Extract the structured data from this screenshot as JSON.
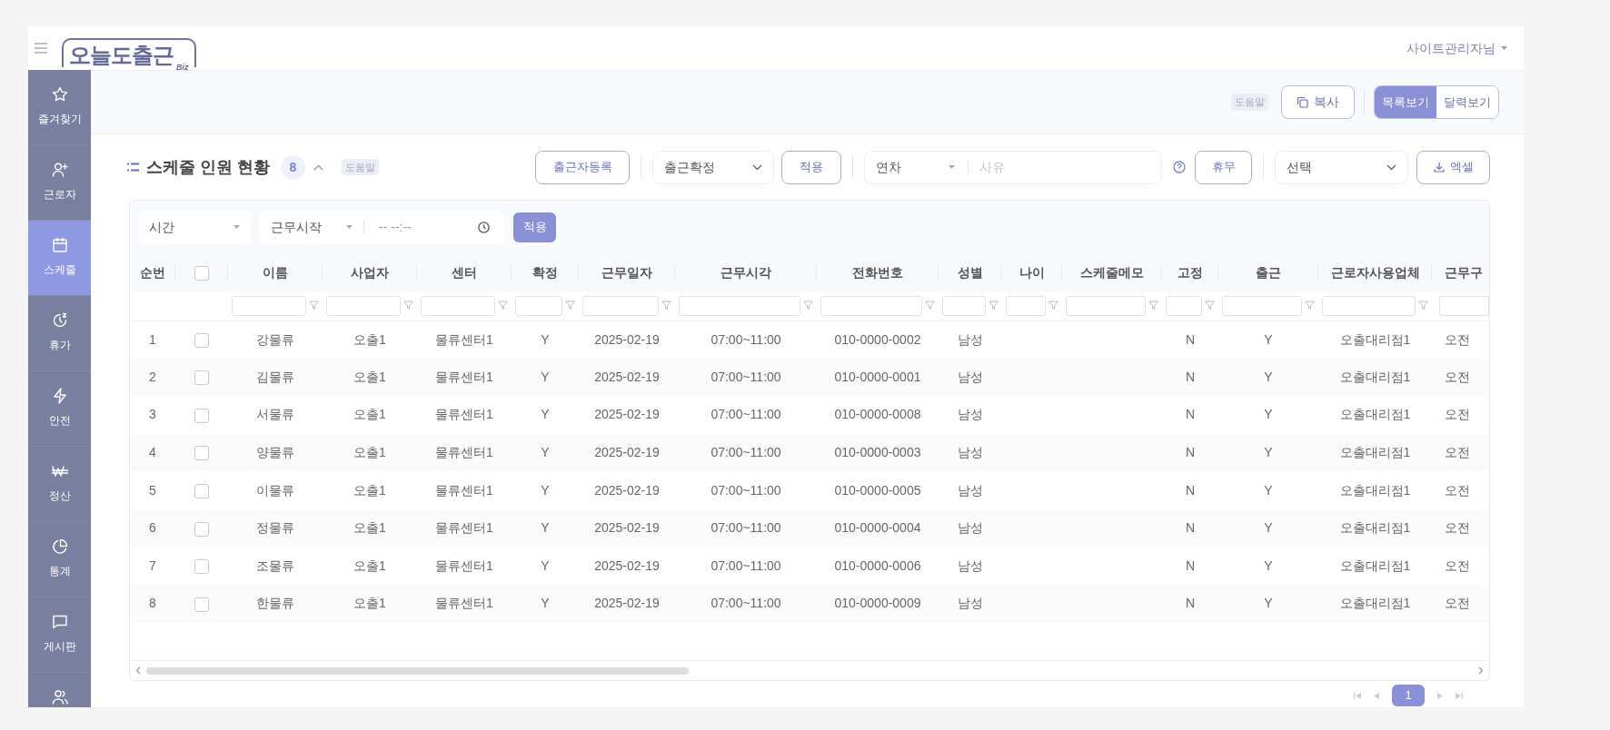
{
  "header": {
    "logo": "오늘도출근",
    "logo_sub": "Biz",
    "user": "사이트관리자님"
  },
  "sidebar": {
    "items": [
      {
        "label": "즐겨찾기",
        "selected": false
      },
      {
        "label": "근로자",
        "selected": false
      },
      {
        "label": "스케줄",
        "selected": true
      },
      {
        "label": "휴가",
        "selected": false
      },
      {
        "label": "안전",
        "selected": false
      },
      {
        "label": "정산",
        "selected": false
      },
      {
        "label": "통계",
        "selected": false
      },
      {
        "label": "게시판",
        "selected": false
      },
      {
        "selected": false
      }
    ]
  },
  "toolbar": {
    "help": "도움말",
    "copy": "복사",
    "views": [
      {
        "label": "목록보기",
        "selected": true
      },
      {
        "label": "달력보기",
        "selected": false
      }
    ]
  },
  "section": {
    "title": "스케줄 인원 현황",
    "count": "8",
    "help": "도움말",
    "register": "출근자등록",
    "confirm_select": "출근확정",
    "apply": "적용",
    "leave_type": "연차",
    "reason_placeholder": "사유",
    "off": "휴무",
    "choice_select": "선택",
    "excel": "엑셀"
  },
  "filter": {
    "type": "시간",
    "field": "근무시작",
    "time_placeholder": "-- --:--",
    "apply": "적용"
  },
  "table": {
    "select_all": {
      "checked": false
    },
    "columns": [
      {
        "kind": "index",
        "label": "순번"
      },
      {
        "kind": "checkbox"
      },
      {
        "kind": "text",
        "label": "이름"
      },
      {
        "kind": "text",
        "label": "사업자"
      },
      {
        "kind": "text",
        "label": "센터"
      },
      {
        "kind": "text",
        "label": "확정"
      },
      {
        "kind": "text",
        "label": "근무일자"
      },
      {
        "kind": "text",
        "label": "근무시각"
      },
      {
        "kind": "text",
        "label": "전화번호"
      },
      {
        "kind": "text",
        "label": "성별"
      },
      {
        "kind": "text",
        "label": "나이"
      },
      {
        "kind": "text",
        "label": "스케줄메모"
      },
      {
        "kind": "text",
        "label": "고정"
      },
      {
        "kind": "text",
        "label": "출근"
      },
      {
        "kind": "text",
        "label": "근로자사용업체"
      },
      {
        "kind": "text",
        "label": "근무구"
      }
    ],
    "rows": [
      {
        "checked": false,
        "cells": [
          "1",
          "",
          "강물류",
          "오출1",
          "물류센터1",
          "Y",
          "2025-02-19",
          "07:00~11:00",
          "010-0000-0002",
          "남성",
          "",
          "",
          "N",
          "Y",
          "오출대리점1",
          "오전"
        ]
      },
      {
        "checked": false,
        "cells": [
          "2",
          "",
          "김물류",
          "오출1",
          "물류센터1",
          "Y",
          "2025-02-19",
          "07:00~11:00",
          "010-0000-0001",
          "남성",
          "",
          "",
          "N",
          "Y",
          "오출대리점1",
          "오전"
        ]
      },
      {
        "checked": false,
        "cells": [
          "3",
          "",
          "서물류",
          "오출1",
          "물류센터1",
          "Y",
          "2025-02-19",
          "07:00~11:00",
          "010-0000-0008",
          "남성",
          "",
          "",
          "N",
          "Y",
          "오출대리점1",
          "오전"
        ]
      },
      {
        "checked": false,
        "cells": [
          "4",
          "",
          "양물류",
          "오출1",
          "물류센터1",
          "Y",
          "2025-02-19",
          "07:00~11:00",
          "010-0000-0003",
          "남성",
          "",
          "",
          "N",
          "Y",
          "오출대리점1",
          "오전"
        ]
      },
      {
        "checked": false,
        "cells": [
          "5",
          "",
          "이물류",
          "오출1",
          "물류센터1",
          "Y",
          "2025-02-19",
          "07:00~11:00",
          "010-0000-0005",
          "남성",
          "",
          "",
          "N",
          "Y",
          "오출대리점1",
          "오전"
        ]
      },
      {
        "checked": false,
        "cells": [
          "6",
          "",
          "정물류",
          "오출1",
          "물류센터1",
          "Y",
          "2025-02-19",
          "07:00~11:00",
          "010-0000-0004",
          "남성",
          "",
          "",
          "N",
          "Y",
          "오출대리점1",
          "오전"
        ]
      },
      {
        "checked": false,
        "cells": [
          "7",
          "",
          "조물류",
          "오출1",
          "물류센터1",
          "Y",
          "2025-02-19",
          "07:00~11:00",
          "010-0000-0006",
          "남성",
          "",
          "",
          "N",
          "Y",
          "오출대리점1",
          "오전"
        ]
      },
      {
        "checked": false,
        "cells": [
          "8",
          "",
          "한물류",
          "오출1",
          "물류센터1",
          "Y",
          "2025-02-19",
          "07:00~11:00",
          "010-0000-0009",
          "남성",
          "",
          "",
          "N",
          "Y",
          "오출대리점1",
          "오전"
        ]
      }
    ]
  },
  "pagination": {
    "pages": [
      {
        "label": "1",
        "selected": true
      }
    ]
  }
}
